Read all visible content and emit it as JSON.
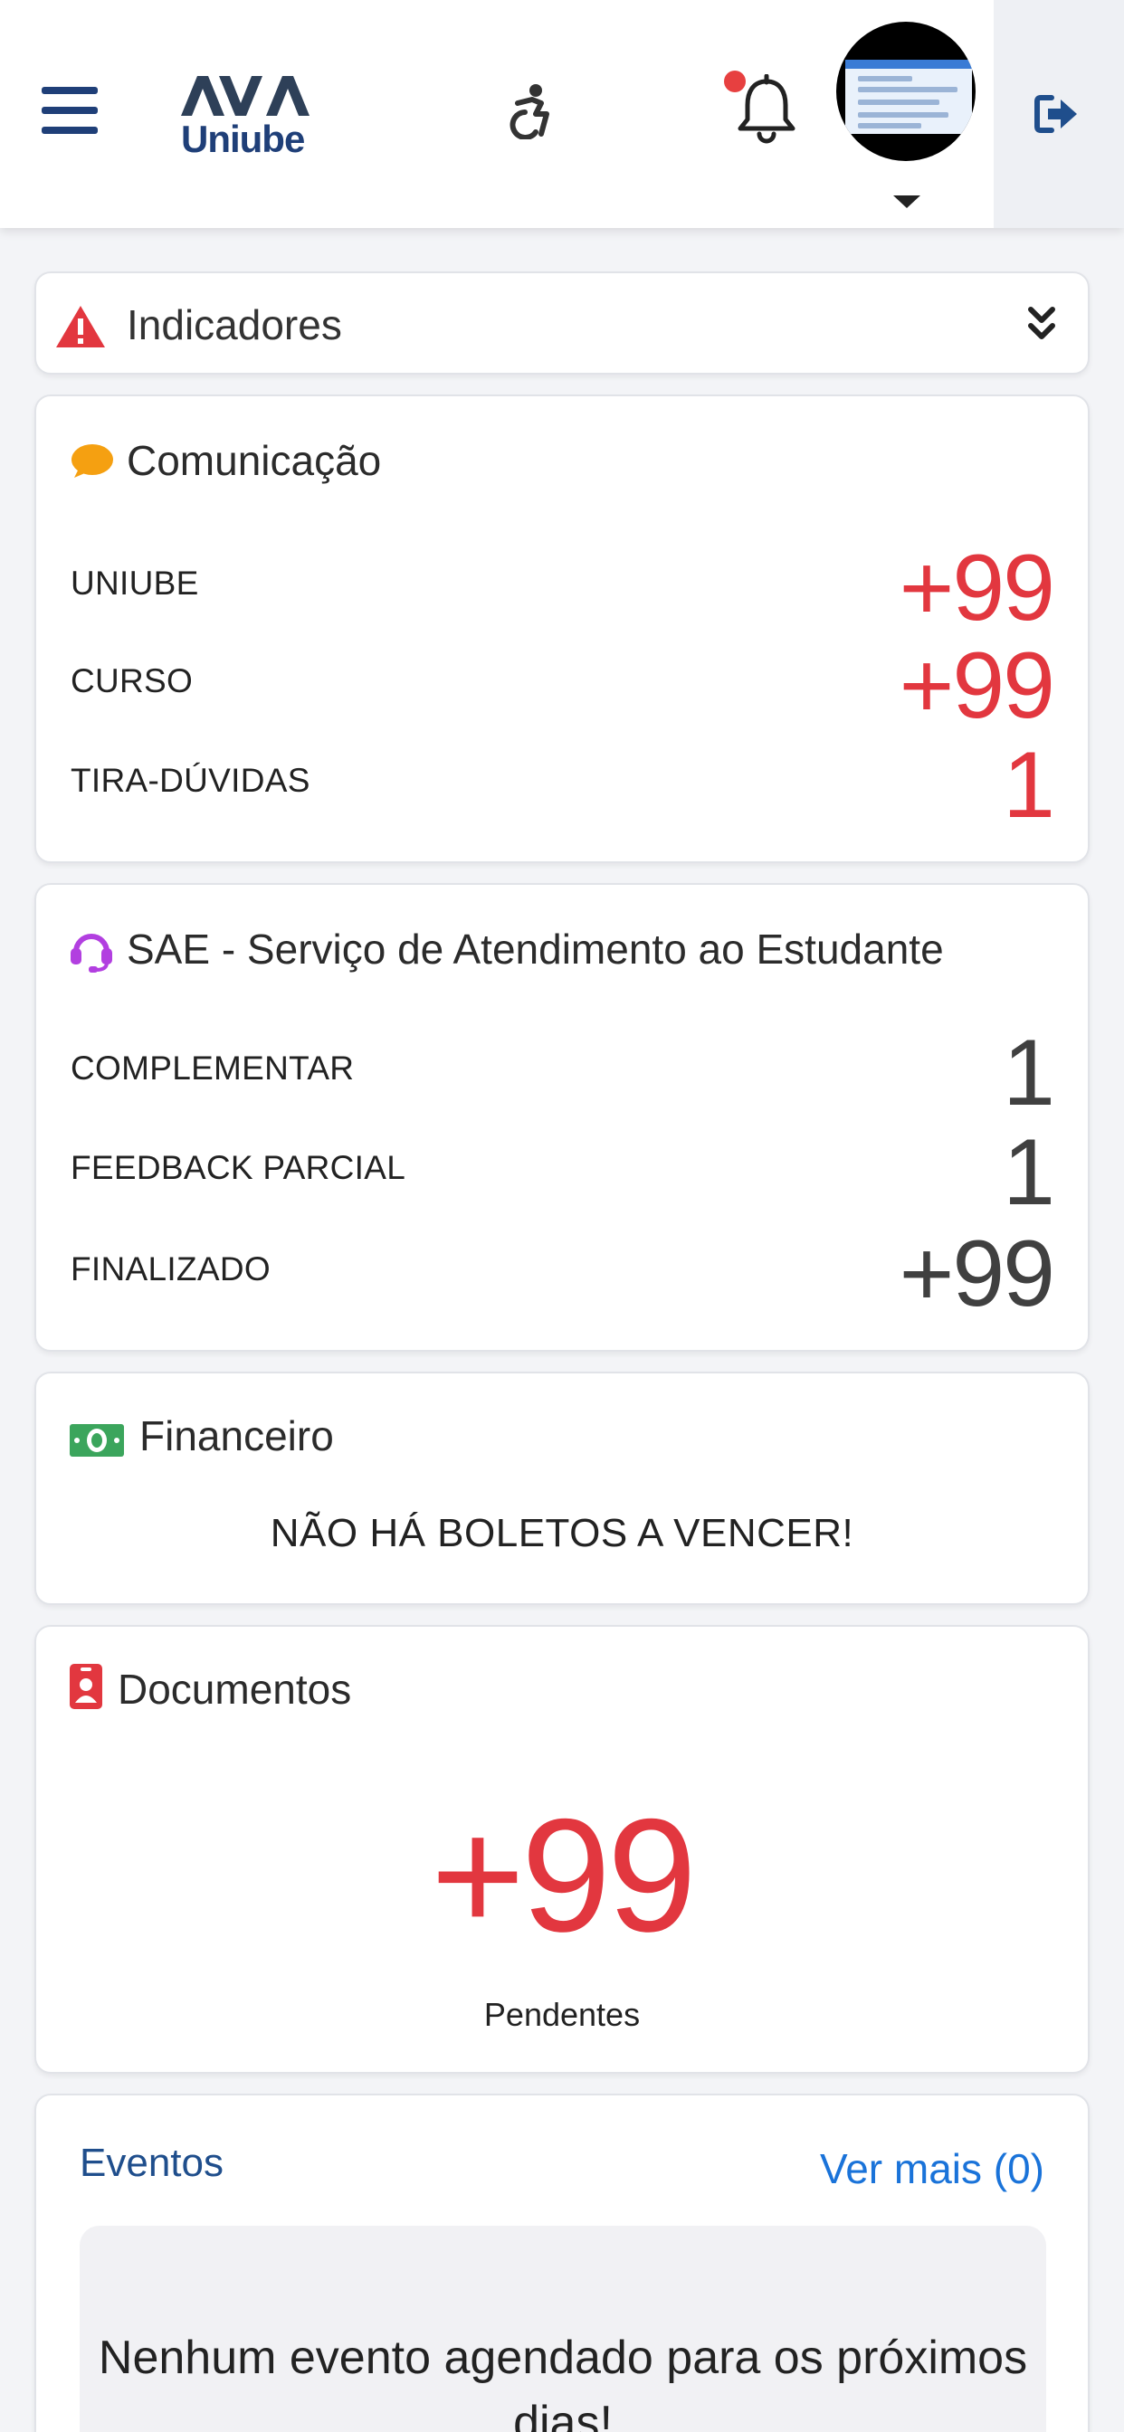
{
  "header": {
    "logo": {
      "wordmark": "AVA",
      "text": "Uniube"
    }
  },
  "indicadores": {
    "title": "Indicadores"
  },
  "comunicacao": {
    "title": "Comunicação",
    "rows": [
      {
        "label": "UNIUBE",
        "value": "+99"
      },
      {
        "label": "CURSO",
        "value": "+99"
      },
      {
        "label": "TIRA-DÚVIDAS",
        "value": "1"
      }
    ]
  },
  "sae": {
    "title": "SAE - Serviço de Atendimento ao Estudante",
    "rows": [
      {
        "label": "COMPLEMENTAR",
        "value": "1"
      },
      {
        "label": "FEEDBACK PARCIAL",
        "value": "1"
      },
      {
        "label": "FINALIZADO",
        "value": "+99"
      }
    ]
  },
  "financeiro": {
    "title": "Financeiro",
    "message": "NÃO HÁ BOLETOS A VENCER!"
  },
  "documentos": {
    "title": "Documentos",
    "count": "+99",
    "subtitle": "Pendentes"
  },
  "eventos": {
    "title": "Eventos",
    "more_label": "Ver mais (0)",
    "empty_message": "Nenhum evento agendado para os próximos dias!"
  },
  "colors": {
    "brand_navy": "#1f3f78",
    "alert_red": "#e2373f",
    "link_blue": "#1a73d9",
    "chat_orange": "#f5a011",
    "headset_purple": "#b23fe0",
    "money_green": "#3ba55c"
  },
  "icons": [
    "menu-icon",
    "ava-logo",
    "accessibility-icon",
    "bell-icon",
    "avatar",
    "caret-down-icon",
    "logout-icon",
    "warning-icon",
    "double-chevron-down-icon",
    "chat-bubble-icon",
    "headset-icon",
    "money-icon",
    "id-badge-icon"
  ]
}
